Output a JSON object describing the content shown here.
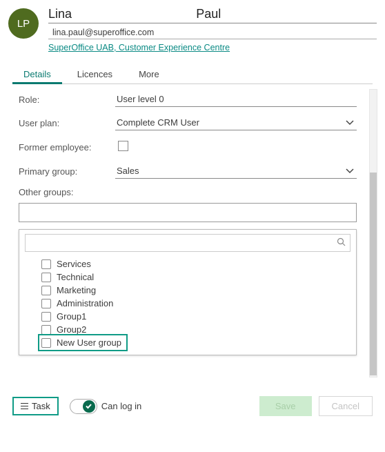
{
  "avatar_initials": "LP",
  "first_name": "Lina",
  "last_name": "Paul",
  "email": "lina.paul@superoffice.com",
  "company": "SuperOffice UAB, Customer Experience Centre",
  "tabs": {
    "details": "Details",
    "licences": "Licences",
    "more": "More"
  },
  "form": {
    "role_label": "Role:",
    "role_value": "User level 0",
    "plan_label": "User plan:",
    "plan_value": "Complete CRM User",
    "former_label": "Former employee:",
    "primary_label": "Primary group:",
    "primary_value": "Sales",
    "other_label": "Other groups:"
  },
  "groups": [
    "Services",
    "Technical",
    "Marketing",
    "Administration",
    "Group1",
    "Group2",
    "New User group"
  ],
  "highlight_index": 6,
  "footer": {
    "task": "Task",
    "can_login": "Can log in",
    "save": "Save",
    "cancel": "Cancel"
  }
}
